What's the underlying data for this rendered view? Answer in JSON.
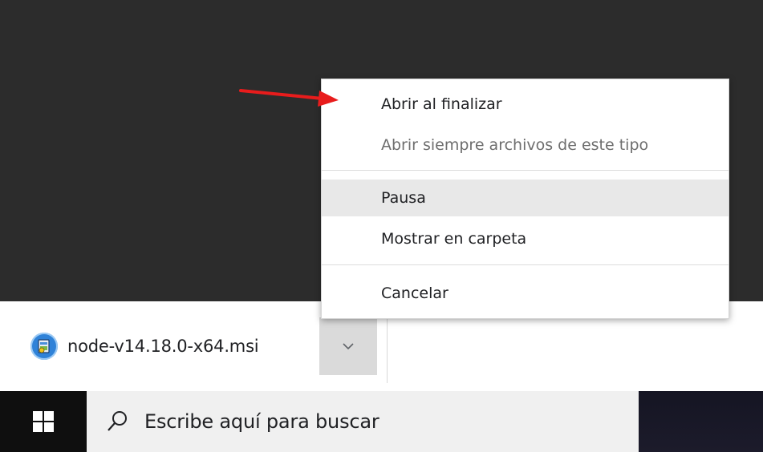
{
  "download": {
    "filename": "node-v14.18.0-x64.msi",
    "file_icon": "msi-installer-icon",
    "options_icon": "chevron-down-icon"
  },
  "context_menu": {
    "items": [
      {
        "label": "Abrir al finalizar",
        "state": "normal"
      },
      {
        "label": "Abrir siempre archivos de este tipo",
        "state": "disabled"
      },
      {
        "label": "Pausa",
        "state": "highlighted"
      },
      {
        "label": "Mostrar en carpeta",
        "state": "normal"
      },
      {
        "label": "Cancelar",
        "state": "normal"
      }
    ]
  },
  "annotation": {
    "type": "red-arrow",
    "color": "#e81c1c",
    "points_to": "Abrir al finalizar"
  },
  "taskbar": {
    "start_icon": "windows-logo-icon",
    "search_icon": "search-icon",
    "search_placeholder": "Escribe aquí para buscar"
  },
  "colors": {
    "page_background": "#2c2c2c",
    "download_bar": "#ffffff",
    "menu_highlight": "#e8e8e8",
    "taskbar": "#0f0f0f",
    "search_box": "#f0f0f0"
  }
}
